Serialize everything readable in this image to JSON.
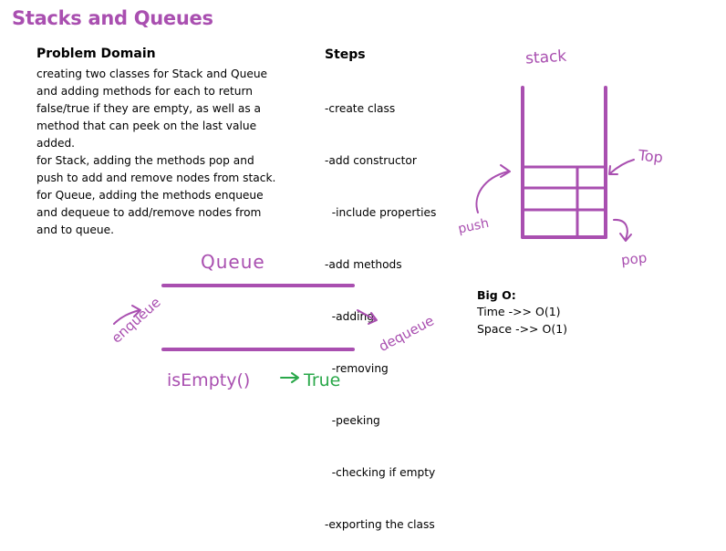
{
  "title": "Stacks and Queues",
  "problem": {
    "heading": "Problem Domain",
    "lines": [
      "creating two classes for Stack and Queue",
      "and adding methods for each to return",
      "false/true if they are empty, as well as a",
      "method that can peek on the last value",
      "added.",
      "for Stack, adding the methods pop and",
      "push to add and remove nodes from stack.",
      "for Queue, adding the methods enqueue",
      "and dequeue to add/remove nodes from",
      "and to queue."
    ]
  },
  "steps": {
    "heading": "Steps",
    "lines": [
      "-create class",
      "-add constructor",
      "  -include properties",
      "-add methods",
      "  -adding",
      "  -removing",
      "  -peeking",
      "  -checking if empty",
      "-exporting the class"
    ]
  },
  "big_o": {
    "heading": "Big O:",
    "lines": [
      "Time ->> O(1)",
      "Space ->> O(1)"
    ]
  },
  "diagram": {
    "stack_label": "stack",
    "top_label": "Top",
    "push_label": "push",
    "pop_label": "pop",
    "queue_label": "Queue",
    "enqueue_label": "enqueue",
    "dequeue_label": "dequeue",
    "isempty_label": "isEmpty()",
    "isempty_result": "True",
    "colors": {
      "accent": "#a94fb0",
      "result": "#2aa84a"
    }
  }
}
